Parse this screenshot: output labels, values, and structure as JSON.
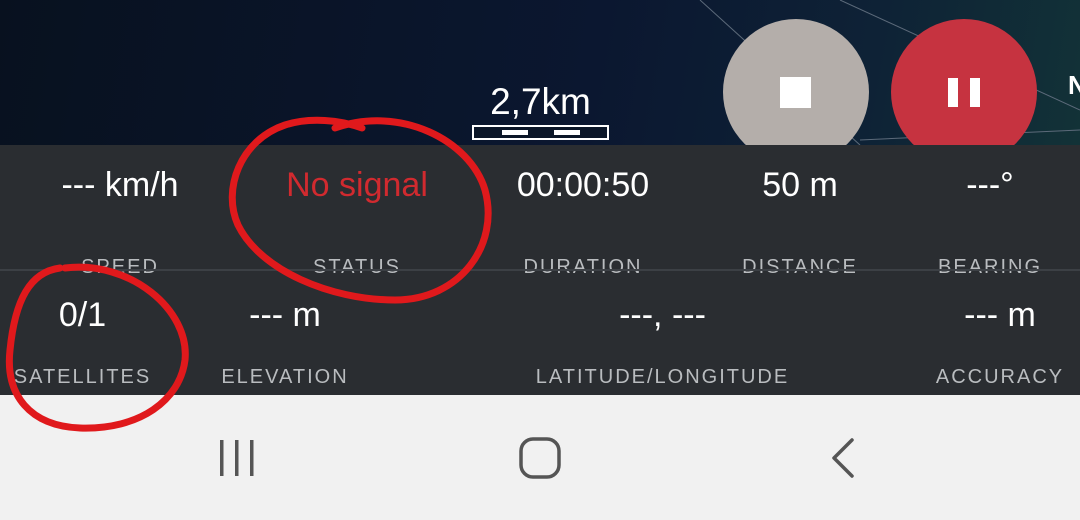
{
  "map": {
    "scale_label": "2,7km",
    "compass_letter": "N"
  },
  "controls": {
    "stop_icon": "stop-icon",
    "pause_icon": "pause-icon",
    "colors": {
      "stop": "#b4aeaa",
      "pause": "#c63340"
    }
  },
  "stats": {
    "row1": [
      {
        "value": "--- km/h",
        "label": "SPEED"
      },
      {
        "value": "No signal",
        "label": "STATUS"
      },
      {
        "value": "00:00:50",
        "label": "DURATION"
      },
      {
        "value": "50 m",
        "label": "DISTANCE"
      },
      {
        "value": "---°",
        "label": "BEARING"
      }
    ],
    "row2": [
      {
        "value": "0/1",
        "label": "SATELLITES"
      },
      {
        "value": "--- m",
        "label": "ELEVATION"
      },
      {
        "value": "---, ---",
        "label": "LATITUDE/LONGITUDE"
      },
      {
        "value": "--- m",
        "label": "ACCURACY"
      }
    ],
    "status_color": "#d12a2f"
  },
  "navbar": {
    "recents_icon": "recents-icon",
    "home_icon": "home-icon",
    "back_icon": "back-icon"
  },
  "annotations": {
    "color": "#e0191c"
  }
}
